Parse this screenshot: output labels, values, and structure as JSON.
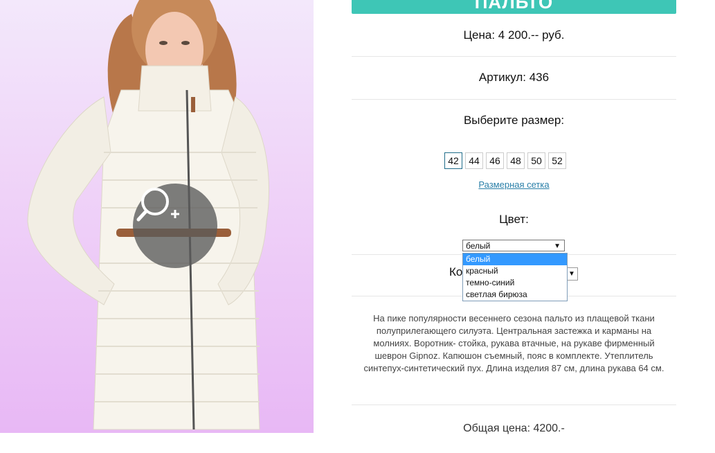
{
  "product": {
    "title": "ПАЛЬТО",
    "price": "Цена: 4 200.-- руб.",
    "article": "Артикул: 436",
    "choose_size": "Выберите размер:",
    "sizes": [
      "42",
      "44",
      "46",
      "48",
      "50",
      "52"
    ],
    "selected_size": "42",
    "size_chart_link": "Размерная сетка",
    "color_label": "Цвет:",
    "color_select": {
      "value": "белый",
      "options": [
        "белый",
        "красный",
        "темно-синий",
        "светлая бирюза"
      ],
      "selected_index": 0
    },
    "quantity_label": "Ко",
    "description": "На пике популярности весеннего сезона пальто из плащевой ткани полуприлегающего силуэта. Центральная застежка и карманы на молниях. Воротник- стойка, рукава втачные, на рукаве фирменный шеврон Gipnoz. Капюшон съемный, пояс в комплекте. Утеплитель синтепух-синтетический пух. Длина изделия 87 см, длина рукава 64 см.",
    "total": "Общая цена: 4200.-"
  },
  "colors": {
    "accent": "#3ec6b6",
    "link": "#2a7fa8",
    "dropdown_highlight": "#3399ff"
  },
  "icons": {
    "zoom": "zoom-in-icon"
  }
}
